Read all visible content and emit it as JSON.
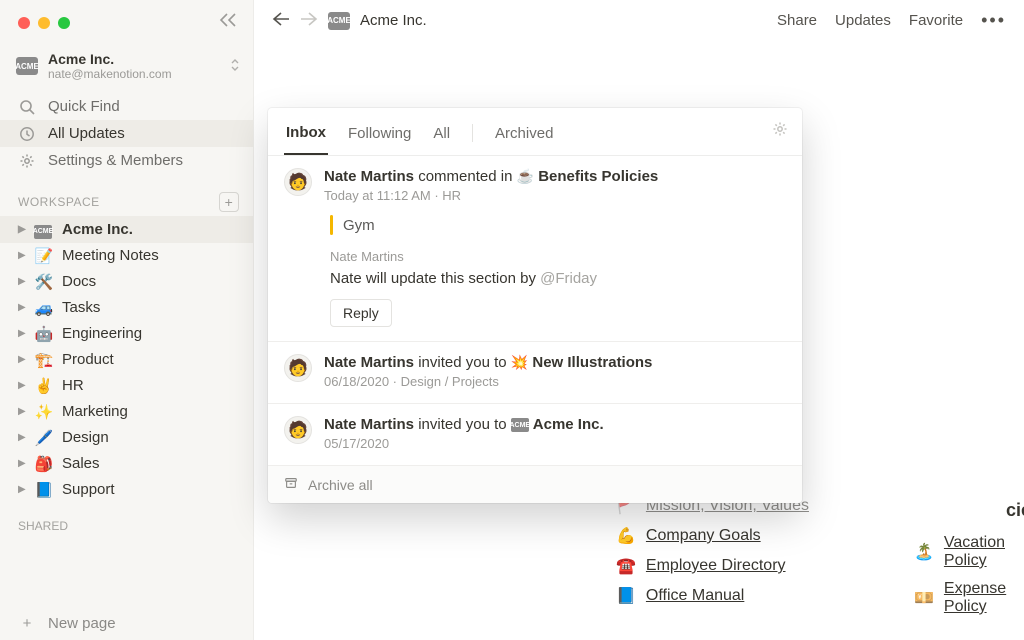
{
  "workspace": {
    "name": "Acme Inc.",
    "email": "nate@makenotion.com",
    "icon_label": "ACME"
  },
  "sidebar_nav": {
    "quick_find": "Quick Find",
    "all_updates": "All Updates",
    "settings": "Settings & Members"
  },
  "section": {
    "workspace": "WORKSPACE",
    "shared": "SHARED"
  },
  "tree": [
    {
      "emoji_type": "badge",
      "label": "Acme Inc.",
      "selected": true
    },
    {
      "emoji": "📝",
      "label": "Meeting Notes"
    },
    {
      "emoji": "🛠️",
      "label": "Docs",
      "emoji_alt": "🔧"
    },
    {
      "emoji": "🚙",
      "label": "Tasks"
    },
    {
      "emoji": "🤖",
      "label": "Engineering"
    },
    {
      "emoji": "🏗️",
      "label": "Product"
    },
    {
      "emoji": "✌️",
      "label": "HR"
    },
    {
      "emoji": "✨",
      "label": "Marketing"
    },
    {
      "emoji": "🖊️",
      "label": "Design"
    },
    {
      "emoji": "🎒",
      "label": "Sales"
    },
    {
      "emoji": "📘",
      "label": "Support"
    }
  ],
  "newpage_label": "New page",
  "topbar": {
    "title": "Acme Inc.",
    "actions": {
      "share": "Share",
      "updates": "Updates",
      "favorite": "Favorite"
    }
  },
  "panel": {
    "tabs": {
      "inbox": "Inbox",
      "following": "Following",
      "all": "All",
      "archived": "Archived"
    },
    "archive_all": "Archive all",
    "notifs": [
      {
        "author": "Nate Martins",
        "verb": "commented in",
        "target_emoji": "☕",
        "target": "Benefits Policies",
        "meta": "Today at 11:12 AM · HR",
        "quote": "Gym",
        "comment_author": "Nate Martins",
        "comment_text_prefix": "Nate will update this section by ",
        "comment_mention": "@Friday",
        "reply": "Reply"
      },
      {
        "author": "Nate Martins",
        "verb": "invited you to",
        "target_emoji": "💥",
        "target": "New Illustrations",
        "meta": "06/18/2020 · Design / Projects"
      },
      {
        "author": "Nate Martins",
        "verb": "invited you to",
        "target_badge": "ACME",
        "target": "Acme Inc.",
        "meta": "05/17/2020"
      }
    ]
  },
  "bg": {
    "col1": [
      {
        "emoji": "🚩",
        "text": "Mission, Vision, Values",
        "cut": true
      },
      {
        "emoji": "💪",
        "text": "Company Goals"
      },
      {
        "emoji": "☎️",
        "text": "Employee Directory"
      },
      {
        "emoji": "📘",
        "text": "Office Manual"
      }
    ],
    "col2_head_tail": "cies",
    "col2": [
      {
        "emoji": "🏝️",
        "text": "Vacation Policy"
      },
      {
        "emoji": "💴",
        "text": "Expense Policy"
      }
    ]
  }
}
